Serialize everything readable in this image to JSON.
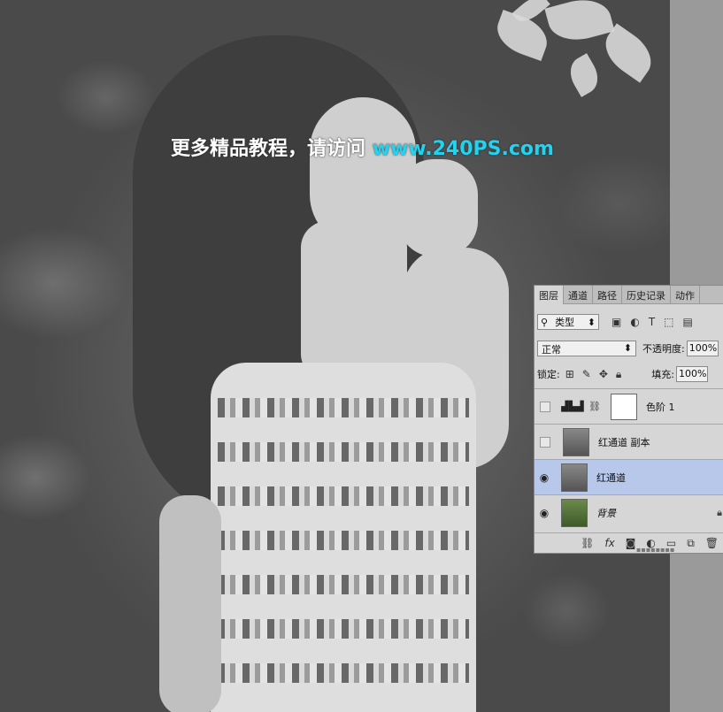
{
  "watermark": {
    "text": "更多精品教程，请访问",
    "url": "www.240PS.com",
    "url_color": "#22d3f0"
  },
  "panel": {
    "tabs": [
      "图层",
      "通道",
      "路径",
      "历史记录",
      "动作"
    ],
    "active_tab": "图层",
    "filter": {
      "icon": "search-icon",
      "label": "类型"
    },
    "filter_icons": [
      "image-icon",
      "adjustment-icon",
      "type-icon",
      "shape-icon",
      "smart-object-icon"
    ],
    "blend_mode": "正常",
    "opacity_label": "不透明度:",
    "opacity_value": "100%",
    "lock_label": "锁定:",
    "lock_icons": [
      "lock-transparent-icon",
      "lock-paint-icon",
      "lock-move-icon",
      "lock-all-icon"
    ],
    "fill_label": "填充:",
    "fill_value": "100%",
    "layers": [
      {
        "name": "色阶 1",
        "type": "adjustment",
        "visible": false,
        "selected": false
      },
      {
        "name": "红通道 副本",
        "type": "bw",
        "visible": false,
        "selected": false
      },
      {
        "name": "红通道",
        "type": "bw",
        "visible": true,
        "selected": true
      },
      {
        "name": "背景",
        "type": "color",
        "visible": true,
        "selected": false,
        "locked": true
      }
    ],
    "bottom_icons": [
      "link-icon",
      "fx-icon",
      "mask-icon",
      "adjustment-layer-icon",
      "folder-icon",
      "new-layer-icon",
      "trash-icon"
    ]
  },
  "colors": {
    "selected_layer": "#b7c8ea",
    "panel_bg": "#d6d6d6"
  }
}
